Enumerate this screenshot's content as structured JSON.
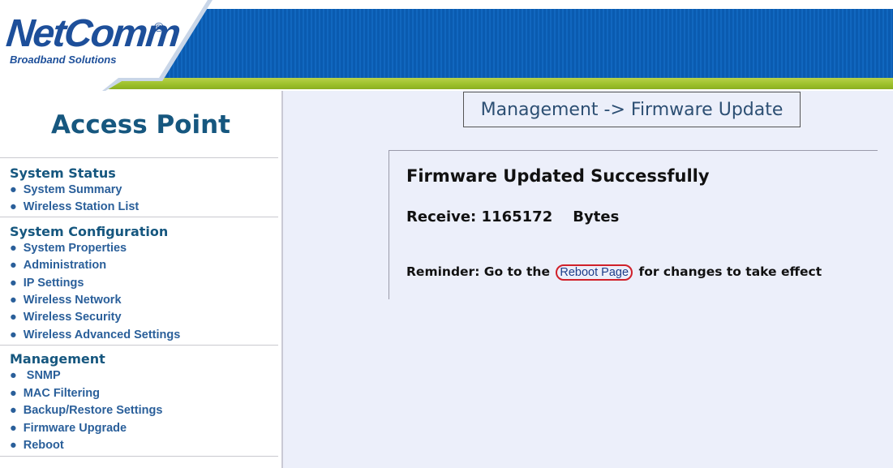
{
  "header": {
    "logo_text": "NetComm",
    "logo_registered": "®",
    "logo_tagline": "Broadband Solutions",
    "banner_color": "#0a5bb0",
    "accent_color": "#9bbf2a"
  },
  "sidebar": {
    "title": "Access Point",
    "sections": [
      {
        "heading": "System Status",
        "items": [
          "System Summary",
          "Wireless Station List"
        ]
      },
      {
        "heading": "System Configuration",
        "items": [
          "System Properties",
          "Administration",
          "IP Settings",
          "Wireless Network",
          "Wireless Security",
          "Wireless Advanced Settings"
        ]
      },
      {
        "heading": "Management",
        "items": [
          " SNMP",
          "MAC Filtering",
          "Backup/Restore Settings",
          "Firmware Upgrade",
          "Reboot"
        ]
      }
    ]
  },
  "main": {
    "breadcrumb": "Management -> Firmware Update",
    "message_title": "Firmware Updated Successfully",
    "receive_label": "Receive:",
    "receive_value": "1165172",
    "receive_unit": "Bytes",
    "reminder_prefix": "Reminder: Go to the",
    "reboot_link": "Reboot Page",
    "reminder_suffix": "for changes to take effect",
    "highlight_color": "#d0202a"
  }
}
